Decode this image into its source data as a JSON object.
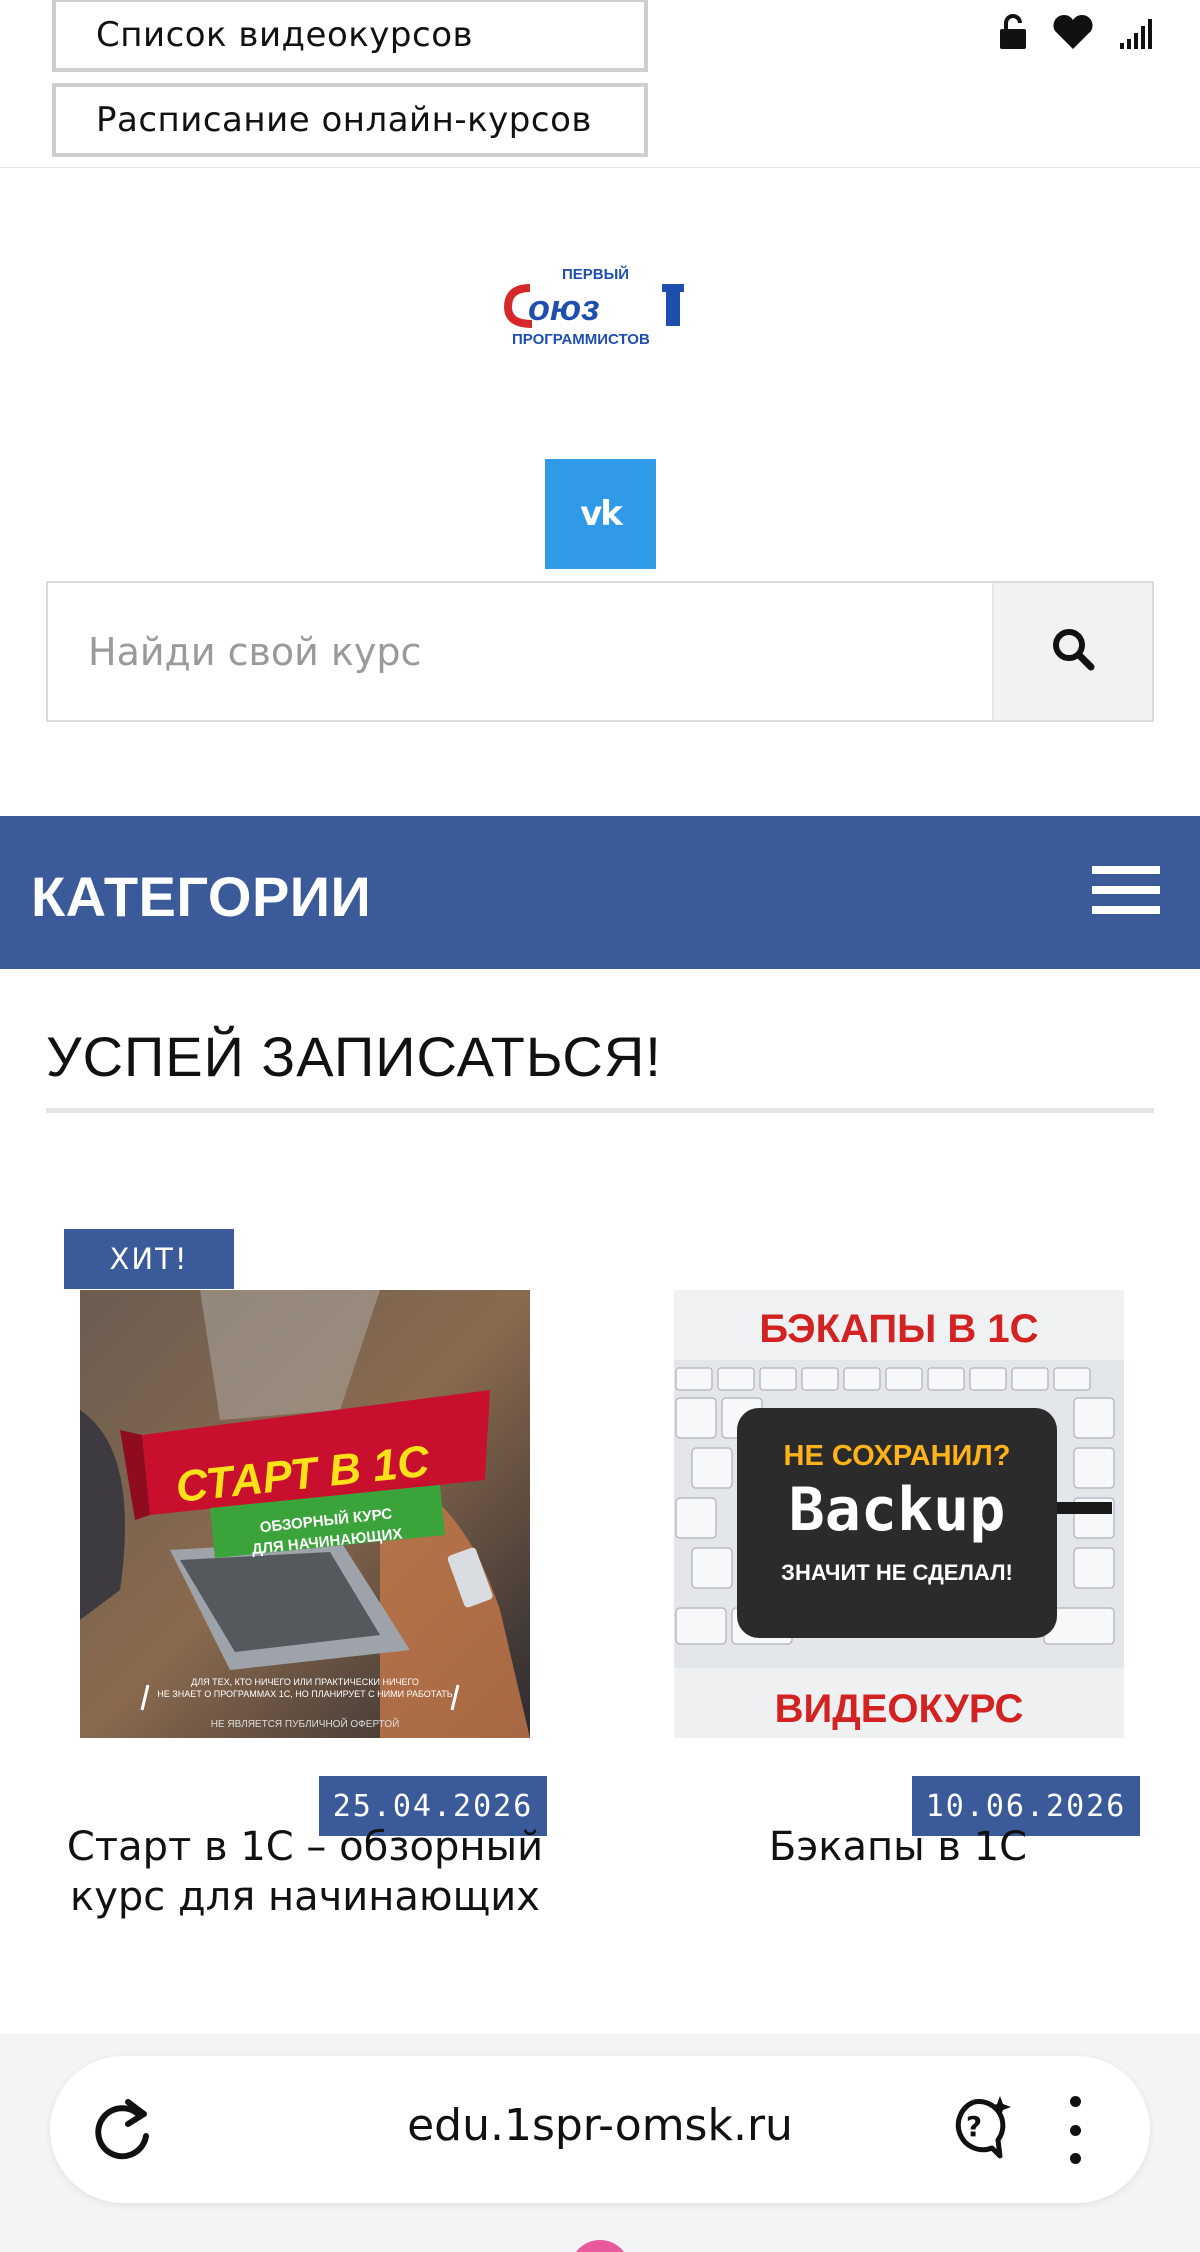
{
  "top_nav": {
    "video_courses_label": "Список видеокурсов",
    "online_schedule_label": "Расписание онлайн-курсов"
  },
  "status_icons": [
    "lock-open-icon",
    "heart-icon",
    "signal-icon"
  ],
  "logo": {
    "top_text": "ПЕРВЫЙ",
    "main_text": "Союз",
    "number": "1",
    "bottom_text": "ПРОГРАММИСТОВ"
  },
  "social": {
    "vk_label": "vk"
  },
  "search": {
    "placeholder": "Найди свой курс",
    "value": ""
  },
  "categories": {
    "title": "КАТЕГОРИИ"
  },
  "section": {
    "title": "УСПЕЙ ЗАПИСАТЬСЯ!"
  },
  "courses": [
    {
      "badge": "ХИТ!",
      "date": "25.04.2026",
      "title": "Старт в 1С – обзорный курс для начинающих",
      "image": {
        "headline": "СТАРТ В 1С",
        "subline1": "ОБЗОРНЫЙ КУРС",
        "subline2": "ДЛЯ НАЧИНАЮЩИХ",
        "caption1": "ДЛЯ ТЕХ, КТО НИЧЕГО ИЛИ ПРАКТИЧЕСКИ НИЧЕГО",
        "caption2": "НЕ ЗНАЕТ О ПРОГРАММАХ 1С, НО ПЛАНИРУЕТ С НИМИ РАБОТАТЬ",
        "disclaimer": "НЕ ЯВЛЯЕТСЯ ПУБЛИЧНОЙ ОФЕРТОЙ"
      }
    },
    {
      "badge": "",
      "date": "10.06.2026",
      "title": "Бэкапы в 1С",
      "image": {
        "headline": "БЭКАПЫ В 1С",
        "line1": "НЕ СОХРАНИЛ?",
        "line2": "Backup",
        "line3": "ЗНАЧИТ НЕ СДЕЛАЛ!",
        "footer": "ВИДЕОКУРС"
      }
    }
  ],
  "browser": {
    "url": "edu.1spr-omsk.ru"
  },
  "colors": {
    "primary": "#3b5a9a",
    "vk": "#2f9ae8",
    "logo_red": "#d62828",
    "logo_blue": "#1f4fae"
  }
}
